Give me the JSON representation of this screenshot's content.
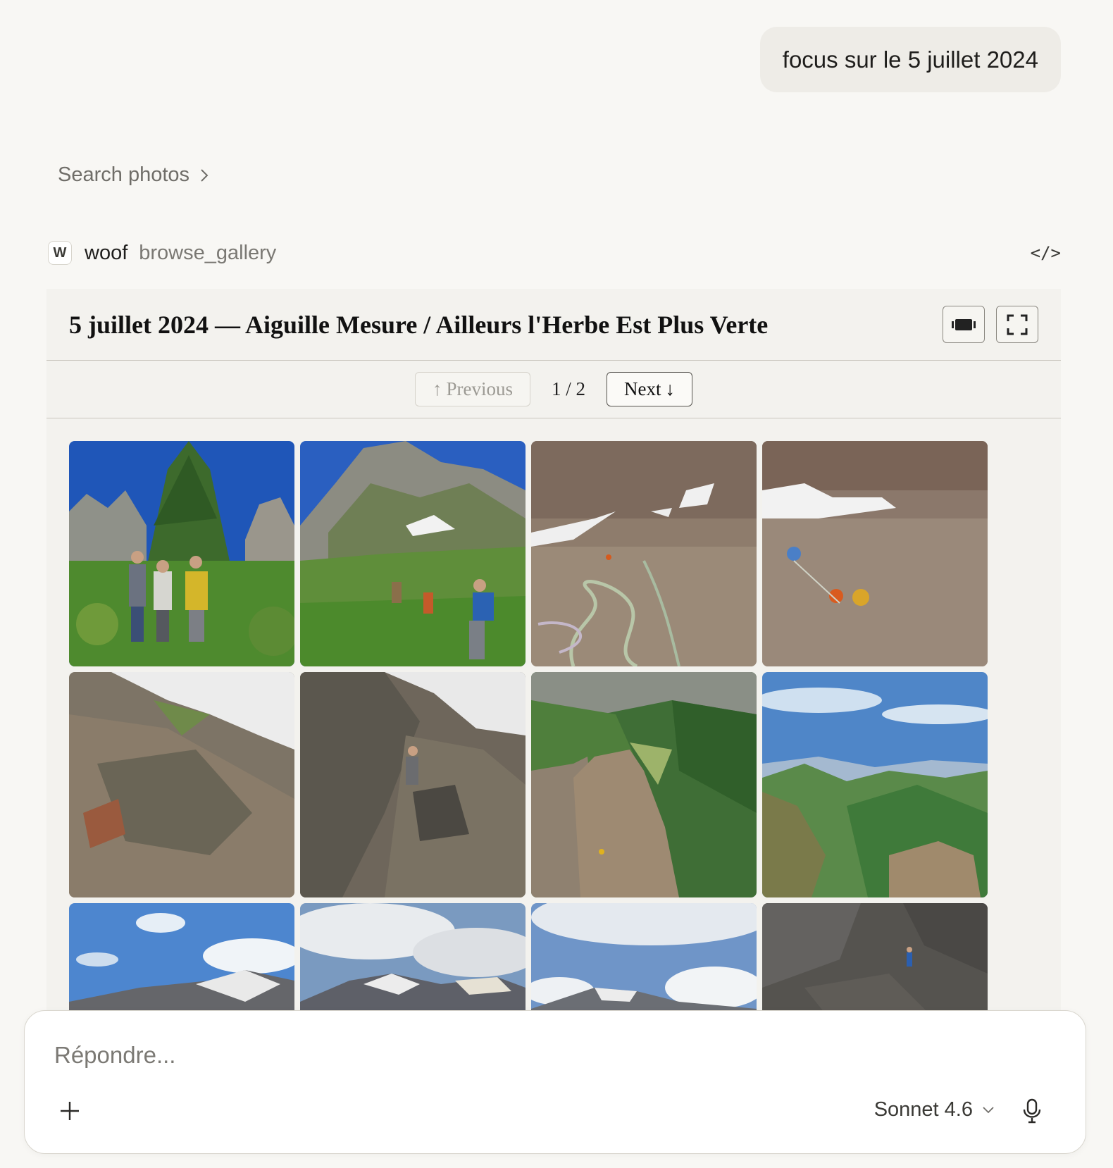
{
  "user_message": "focus sur le 5 juillet 2024",
  "search_link": {
    "label": "Search photos",
    "icon": "chevron-right-icon"
  },
  "tool_call": {
    "badge": "W",
    "app": "woof",
    "function": "browse_gallery",
    "code_icon": "code-icon"
  },
  "gallery": {
    "title": "5 juillet 2024 — Aiguille Mesure / Ailleurs l'Herbe Est Plus Verte",
    "controls": [
      "slideshow-icon",
      "fullscreen-icon"
    ],
    "pager": {
      "previous": "Previous",
      "next": "Next",
      "count": "1 / 2"
    },
    "photos": [
      {
        "name": "photo-group-meadow"
      },
      {
        "name": "photo-hikers-slope"
      },
      {
        "name": "photo-rock-rope"
      },
      {
        "name": "photo-climbers-slab"
      },
      {
        "name": "photo-rocky-ridge-snow"
      },
      {
        "name": "photo-climber-crag"
      },
      {
        "name": "photo-valley-pinnacle"
      },
      {
        "name": "photo-valley-panorama"
      },
      {
        "name": "photo-peaks-sky-1"
      },
      {
        "name": "photo-peaks-clouds-2"
      },
      {
        "name": "photo-peaks-clouds-3"
      },
      {
        "name": "photo-rock-wall-climber"
      }
    ]
  },
  "composer": {
    "placeholder": "Répondre...",
    "model": "Sonnet 4.6",
    "add_icon": "plus-icon",
    "mic_icon": "microphone-icon"
  }
}
